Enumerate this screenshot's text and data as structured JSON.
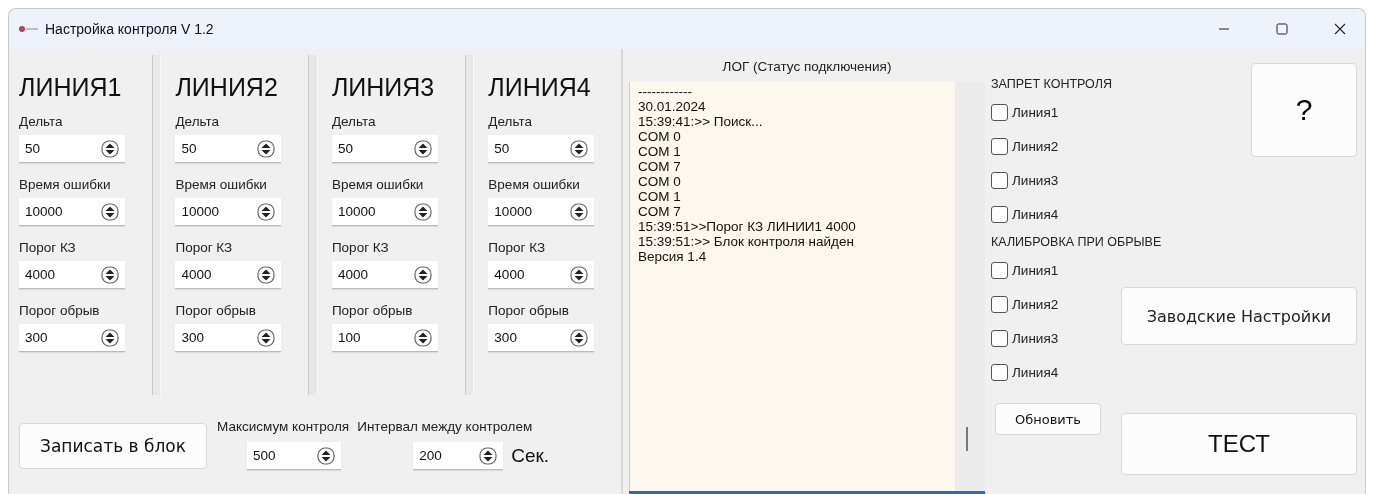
{
  "window": {
    "title": "Настройка контроля V 1.2"
  },
  "lines": [
    {
      "title": "ЛИНИЯ1",
      "fields": [
        {
          "label": "Дельта",
          "value": "50"
        },
        {
          "label": "Время ошибки",
          "value": "10000"
        },
        {
          "label": "Порог КЗ",
          "value": "4000"
        },
        {
          "label": "Порог обрыв",
          "value": "300"
        }
      ]
    },
    {
      "title": "ЛИНИЯ2",
      "fields": [
        {
          "label": "Дельта",
          "value": "50"
        },
        {
          "label": "Время ошибки",
          "value": "10000"
        },
        {
          "label": "Порог КЗ",
          "value": "4000"
        },
        {
          "label": "Порог обрыв",
          "value": "300"
        }
      ]
    },
    {
      "title": "ЛИНИЯ3",
      "fields": [
        {
          "label": "Дельта",
          "value": "50"
        },
        {
          "label": "Время ошибки",
          "value": "10000"
        },
        {
          "label": "Порог КЗ",
          "value": "4000"
        },
        {
          "label": "Порог обрыв",
          "value": "100"
        }
      ]
    },
    {
      "title": "ЛИНИЯ4",
      "fields": [
        {
          "label": "Дельта",
          "value": "50"
        },
        {
          "label": "Время ошибки",
          "value": "10000"
        },
        {
          "label": "Порог КЗ",
          "value": "4000"
        },
        {
          "label": "Порог обрыв",
          "value": "300"
        }
      ]
    }
  ],
  "write_button": "Записать в блок",
  "max_control": {
    "label": "Максисмум контроля",
    "value": "500"
  },
  "interval": {
    "label": "Интервал между контролем",
    "value": "200",
    "unit": "Сек."
  },
  "log": {
    "title": "ЛОГ (Статус подключения)",
    "lines": [
      "------------",
      "30.01.2024",
      "15:39:41:>> Поиск...",
      "COM 0",
      "COM 1",
      "COM 7",
      "COM 0",
      "COM 1",
      "COM 7",
      "15:39:51>>Порог КЗ ЛИНИИ1 4000",
      "15:39:51:>> Блок контроля найден",
      "Версия 1.4"
    ]
  },
  "control_ban": {
    "title": "ЗАПРЕТ КОНТРОЛЯ",
    "items": [
      {
        "label": "Линия1",
        "checked": false
      },
      {
        "label": "Линия2",
        "checked": false
      },
      {
        "label": "Линия3",
        "checked": false
      },
      {
        "label": "Линия4",
        "checked": false
      }
    ]
  },
  "calibration": {
    "title": "КАЛИБРОВКА ПРИ ОБРЫВЕ",
    "items": [
      {
        "label": "Линия1",
        "checked": false
      },
      {
        "label": "Линия2",
        "checked": false
      },
      {
        "label": "Линия3",
        "checked": false
      },
      {
        "label": "Линия4",
        "checked": false
      }
    ]
  },
  "help_button": "?",
  "factory_button": "Заводские Настройки",
  "refresh_button": "Обновить",
  "test_button": "ТЕСТ"
}
